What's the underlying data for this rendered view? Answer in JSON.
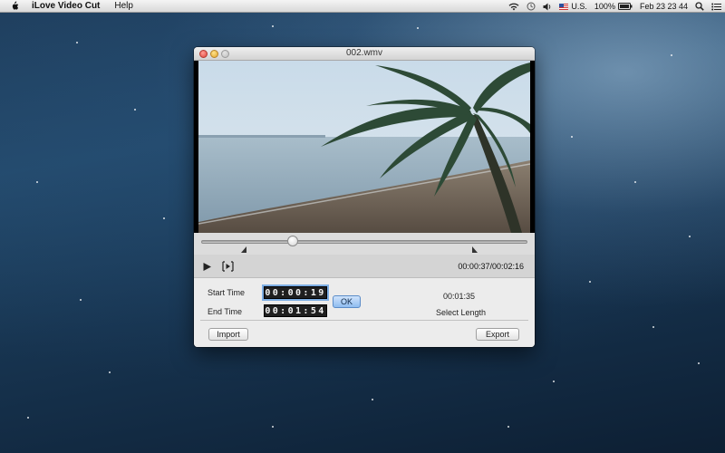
{
  "menubar": {
    "app_name": "iLove Video Cut",
    "items": [
      "Help"
    ],
    "input_source": "U.S.",
    "battery": "100%",
    "clock": "Feb 23  23 44"
  },
  "window": {
    "title": "002.wmv"
  },
  "player": {
    "progress": 0.28,
    "start_marker": 0.13,
    "end_marker": 0.84,
    "timecode": "00:00:37/00:02:16"
  },
  "form": {
    "start_label": "Start Time",
    "start_value": "00:00:19",
    "end_label": "End Time",
    "end_value": "00:01:54",
    "ok_label": "OK",
    "length_value": "00:01:35",
    "length_label": "Select Length",
    "import_label": "Import",
    "export_label": "Export"
  },
  "colors": {
    "desktop": "#1d3a57",
    "window_bg": "#ececec",
    "accent": "#8fbcf0"
  },
  "icons": [
    "apple-icon",
    "wifi-icon",
    "time-machine-icon",
    "volume-icon",
    "flag-icon",
    "battery-icon",
    "spotlight-icon",
    "notification-icon",
    "play-icon",
    "step-frame-icon"
  ]
}
